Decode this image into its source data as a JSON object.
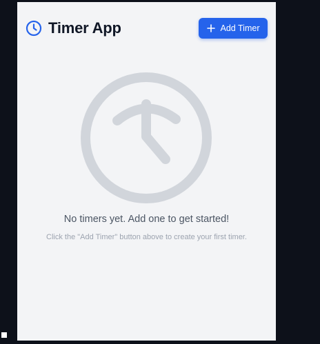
{
  "app": {
    "title": "Timer App",
    "title_icon": "clock-icon",
    "accent_color": "#2563eb"
  },
  "toolbar": {
    "add_timer_label": "Add Timer",
    "add_icon": "plus-icon"
  },
  "empty_state": {
    "illustration_icon": "clock-icon",
    "message": "No timers yet. Add one to get started!",
    "hint": "Click the \"Add Timer\" button above to create your first timer."
  }
}
